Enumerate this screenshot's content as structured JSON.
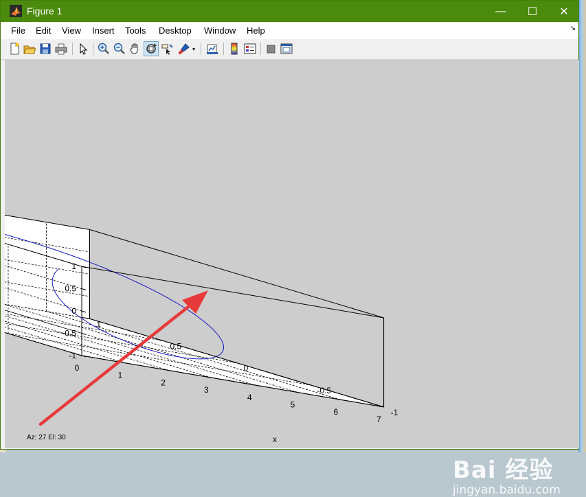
{
  "window": {
    "title": "Figure 1"
  },
  "titlebar_buttons": {
    "minimize": "—",
    "maximize": "☐",
    "close": "✕"
  },
  "menu": [
    "File",
    "Edit",
    "View",
    "Insert",
    "Tools",
    "Desktop",
    "Window",
    "Help"
  ],
  "menu_dock": "↘",
  "toolbar": {
    "icons": [
      "new-figure-icon",
      "open-file-icon",
      "save-icon",
      "print-icon",
      "pointer-icon",
      "zoom-in-icon",
      "zoom-out-icon",
      "pan-hand-icon",
      "rotate-3d-icon",
      "data-cursor-icon",
      "brush-icon",
      "link-plot-icon",
      "colorbar-icon",
      "legend-icon",
      "hide-plot-tools-icon",
      "show-plot-tools-icon"
    ],
    "active": "rotate-3d-icon"
  },
  "status": {
    "text": "Az:   27 El:   30"
  },
  "watermark": {
    "brand": "Bai 经验",
    "site": "jingyan.baidu.com"
  },
  "colors": {
    "title_bar": "#4a8a0c",
    "figure_bg": "#cdcdcd",
    "curve": "#1515c8",
    "arrow": "#e83a3a"
  },
  "chart_data": {
    "type": "line3d",
    "view": {
      "azimuth": 27,
      "elevation": 30
    },
    "xlabel": "x",
    "ylabel": "",
    "zlabel": "",
    "xlim": [
      0,
      7
    ],
    "ylim": [
      -1,
      1
    ],
    "zlim": [
      -1,
      1
    ],
    "xticks": [
      0,
      1,
      2,
      3,
      4,
      5,
      6,
      7
    ],
    "yticks": [
      -1,
      -0.5,
      0,
      0.5,
      1
    ],
    "zticks": [
      -1,
      -0.5,
      0,
      0.5,
      1
    ],
    "grid": true,
    "series": [
      {
        "function": "y = cos(x), z = sin(x)",
        "x_range": [
          0,
          6.2832
        ],
        "samples": 120
      }
    ]
  }
}
